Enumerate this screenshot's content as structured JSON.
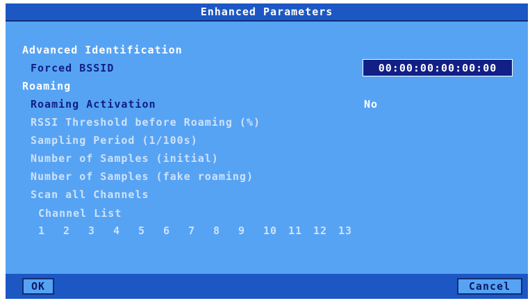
{
  "window": {
    "title": "Enhanced Parameters"
  },
  "sections": {
    "advanced_identification": "Advanced Identification",
    "roaming": "Roaming"
  },
  "fields": {
    "forced_bssid": {
      "label": "Forced BSSID",
      "value": "00:00:00:00:00:00"
    },
    "roaming_activation": {
      "label": "Roaming Activation",
      "value": "No"
    },
    "rssi_threshold": {
      "label": "RSSI Threshold before Roaming (%)"
    },
    "sampling_period": {
      "label": "Sampling Period (1/100s)"
    },
    "samples_initial": {
      "label": "Number of Samples (initial)"
    },
    "samples_fake": {
      "label": "Number of Samples (fake roaming)"
    },
    "scan_all_channels": {
      "label": "Scan all Channels"
    },
    "channel_list": {
      "label": "Channel List"
    }
  },
  "channels": [
    "1",
    "2",
    "3",
    "4",
    "5",
    "6",
    "7",
    "8",
    "9",
    "10",
    "11",
    "12",
    "13"
  ],
  "buttons": {
    "ok": "OK",
    "cancel": "Cancel"
  },
  "colors": {
    "background": "#56a3f4",
    "titlebar": "#1c57c4",
    "active_text": "#0f1f82",
    "inactive_text": "#cfe2f9",
    "field_bg": "#121f86"
  }
}
